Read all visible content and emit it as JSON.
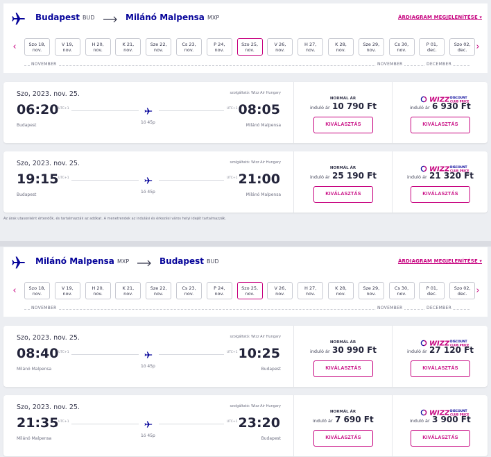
{
  "colors": {
    "brand_purple": "#06049a",
    "brand_magenta": "#c6007e",
    "background": "#eceef2"
  },
  "outbound": {
    "origin_city": "Budapest",
    "origin_code": "BUD",
    "dest_city": "Milánó Malpensa",
    "dest_code": "MXP",
    "fare_chart_link": "ÁRDIAGRAM MEGJELENÍTÉSE",
    "dates": [
      {
        "l1": "Szo 18,",
        "l2": "nov."
      },
      {
        "l1": "V 19,",
        "l2": "nov."
      },
      {
        "l1": "H 20,",
        "l2": "nov."
      },
      {
        "l1": "K 21,",
        "l2": "nov."
      },
      {
        "l1": "Sze 22,",
        "l2": "nov."
      },
      {
        "l1": "Cs 23,",
        "l2": "nov."
      },
      {
        "l1": "P 24,",
        "l2": "nov."
      },
      {
        "l1": "Szo 25,",
        "l2": "nov."
      },
      {
        "l1": "V 26,",
        "l2": "nov."
      },
      {
        "l1": "H 27,",
        "l2": "nov."
      },
      {
        "l1": "K 28,",
        "l2": "nov."
      },
      {
        "l1": "Sze 29,",
        "l2": "nov."
      },
      {
        "l1": "Cs 30,",
        "l2": "nov."
      },
      {
        "l1": "P 01,",
        "l2": "dec."
      },
      {
        "l1": "Szo 02,",
        "l2": "dec."
      }
    ],
    "selected_date_index": 7,
    "month_labels": {
      "m1": "NOVEMBER",
      "m2": "NOVEMBER",
      "m3": "DECEMBER"
    },
    "flights": [
      {
        "date": "Szo, 2023. nov. 25.",
        "operator": "szolgáltató: Wizz Air Hungary",
        "dep_time": "06:20",
        "arr_time": "08:05",
        "utc_dep": "UTC+1",
        "utc_arr": "UTC+1",
        "duration": "1ó 45p",
        "dep_city": "Budapest",
        "arr_city": "Milánó Malpensa",
        "normal_title": "NORMÁL ÁR",
        "from_label": "induló ár",
        "normal_price": "10 790 Ft",
        "club_price": "6 930 Ft",
        "select_label": "KIVÁLASZTÁS"
      },
      {
        "date": "Szo, 2023. nov. 25.",
        "operator": "szolgáltató: Wizz Air Hungary",
        "dep_time": "19:15",
        "arr_time": "21:00",
        "utc_dep": "UTC+1",
        "utc_arr": "UTC+1",
        "duration": "1ó 45p",
        "dep_city": "Budapest",
        "arr_city": "Milánó Malpensa",
        "normal_title": "NORMÁL ÁR",
        "from_label": "induló ár",
        "normal_price": "25 190 Ft",
        "club_price": "21 320 Ft",
        "select_label": "KIVÁLASZTÁS"
      }
    ]
  },
  "disclaimer": "Az árak utasonként értendők, és tartalmazzák az adókat. A menetrendek az indulási és érkezési város helyi idejét tartalmazzák.",
  "inbound": {
    "origin_city": "Milánó Malpensa",
    "origin_code": "MXP",
    "dest_city": "Budapest",
    "dest_code": "BUD",
    "fare_chart_link": "ÁRDIAGRAM MEGJELENÍTÉSE",
    "dates": [
      {
        "l1": "Szo 18,",
        "l2": "nov."
      },
      {
        "l1": "V 19,",
        "l2": "nov."
      },
      {
        "l1": "H 20,",
        "l2": "nov."
      },
      {
        "l1": "K 21,",
        "l2": "nov."
      },
      {
        "l1": "Sze 22,",
        "l2": "nov."
      },
      {
        "l1": "Cs 23,",
        "l2": "nov."
      },
      {
        "l1": "P 24,",
        "l2": "nov."
      },
      {
        "l1": "Szo 25,",
        "l2": "nov."
      },
      {
        "l1": "V 26,",
        "l2": "nov."
      },
      {
        "l1": "H 27,",
        "l2": "nov."
      },
      {
        "l1": "K 28,",
        "l2": "nov."
      },
      {
        "l1": "Sze 29,",
        "l2": "nov."
      },
      {
        "l1": "Cs 30,",
        "l2": "nov."
      },
      {
        "l1": "P 01,",
        "l2": "dec."
      },
      {
        "l1": "Szo 02,",
        "l2": "dec."
      }
    ],
    "selected_date_index": 7,
    "month_labels": {
      "m1": "NOVEMBER",
      "m2": "NOVEMBER",
      "m3": "DECEMBER"
    },
    "flights": [
      {
        "date": "Szo, 2023. nov. 25.",
        "operator": "szolgáltató: Wizz Air Hungary",
        "dep_time": "08:40",
        "arr_time": "10:25",
        "utc_dep": "UTC+1",
        "utc_arr": "UTC+1",
        "duration": "1ó 45p",
        "dep_city": "Milánó Malpensa",
        "arr_city": "Budapest",
        "normal_title": "NORMÁL ÁR",
        "from_label": "induló ár",
        "normal_price": "30 990 Ft",
        "club_price": "27 120 Ft",
        "select_label": "KIVÁLASZTÁS"
      },
      {
        "date": "Szo, 2023. nov. 25.",
        "operator": "szolgáltató: Wizz Air Hungary",
        "dep_time": "21:35",
        "arr_time": "23:20",
        "utc_dep": "UTC+1",
        "utc_arr": "UTC+1",
        "duration": "1ó 45p",
        "dep_city": "Milánó Malpensa",
        "arr_city": "Budapest",
        "normal_title": "NORMÁL ÁR",
        "from_label": "induló ár",
        "normal_price": "7 690 Ft",
        "club_price": "3 900 Ft",
        "select_label": "KIVÁLASZTÁS"
      }
    ]
  },
  "icons": {
    "route_logo": "plane-icon",
    "route_arrow": "arrow-right-icon",
    "nav_prev": "chevron-left-icon",
    "nav_next": "chevron-right-icon",
    "link_arrow": "heart-chevron-icon",
    "flight_plane": "plane-icon",
    "club_badge": "wizz-discount-club-logo"
  }
}
